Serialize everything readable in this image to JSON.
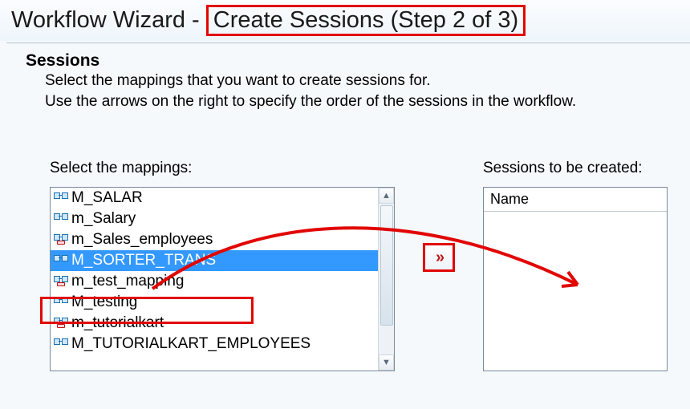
{
  "title": {
    "prefix": "Workflow Wizard - ",
    "highlighted": "Create Sessions (Step 2 of 3)"
  },
  "header": {
    "heading": "Sessions",
    "line1": "Select the mappings that you want to create sessions for.",
    "line2": "Use the arrows on the right to specify the order of the sessions in the workflow."
  },
  "leftList": {
    "label": "Select the mappings:",
    "items": [
      {
        "name": "M_SALAR",
        "variant": "plain",
        "selected": false
      },
      {
        "name": "m_Salary",
        "variant": "plain",
        "selected": false
      },
      {
        "name": "m_Sales_employees",
        "variant": "badged",
        "selected": false
      },
      {
        "name": "M_SORTER_TRANS",
        "variant": "plain",
        "selected": true
      },
      {
        "name": "m_test_mapping",
        "variant": "badged",
        "selected": false
      },
      {
        "name": "M_testing",
        "variant": "plain",
        "selected": false
      },
      {
        "name": "m_tutorialkart",
        "variant": "badged",
        "selected": false
      },
      {
        "name": "M_TUTORIALKART_EMPLOYEES",
        "variant": "plain",
        "selected": false
      }
    ]
  },
  "moveButton": {
    "glyph": "»"
  },
  "rightList": {
    "label": "Sessions to be created:",
    "columnHeader": "Name"
  }
}
